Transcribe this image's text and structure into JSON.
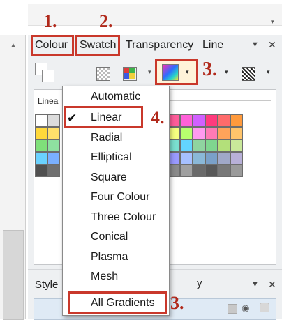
{
  "tabs": [
    {
      "label": "Colour",
      "marker": "1."
    },
    {
      "label": "Swatch",
      "marker": "2."
    },
    {
      "label": "Transparency"
    },
    {
      "label": "Line"
    }
  ],
  "panel_controls": {
    "menu_glyph": "▼",
    "close_glyph": "✕"
  },
  "toolbar": {
    "marker": "3.",
    "gradient_preview_colors": [
      "#ff2fb4",
      "#2f6bff",
      "#28d7c9",
      "#ffdf2a"
    ]
  },
  "swatch_panel": {
    "label": "Linea"
  },
  "swatch_colors": [
    [
      "#ffffff",
      "#dcdcdc",
      "#ff5c9a",
      "#ff60d8",
      "#d060ff",
      "#ff3b7d",
      "#ff6b6b",
      "#ff9a3c"
    ],
    [
      "#ffd83a",
      "#ffe06b",
      "#f6ff80",
      "#b7ff6e",
      "#ff9af0",
      "#ff7ab5",
      "#ffa35a",
      "#ffc46b"
    ],
    [
      "#7fe07a",
      "#8ee0a0",
      "#7ae0d0",
      "#63d4ff",
      "#8fd4a0",
      "#7fd68f",
      "#b3e07a",
      "#c9e89a"
    ],
    [
      "#6ad2ff",
      "#7ab0ff",
      "#9a9aff",
      "#a6c0ff",
      "#8ab8d8",
      "#7aa0c8",
      "#a0a8c8",
      "#b8b0d8"
    ],
    [
      "#505050",
      "#707070",
      "#8a8a8a",
      "#a0a0a0",
      "#6a6a6a",
      "#585858",
      "#787878",
      "#9a9a9a"
    ]
  ],
  "menu": {
    "items": [
      "Automatic",
      "Linear",
      "Radial",
      "Elliptical",
      "Square",
      "Four Colour",
      "Three Colour",
      "Conical",
      "Plasma",
      "Mesh",
      "All Gradients"
    ],
    "checked_index": 1,
    "check_glyph": "✔",
    "linear_marker": "4.",
    "all_gradients_marker": "3."
  },
  "styles_panel": {
    "label": "Style",
    "partial_label": "y",
    "menu_glyph": "▼",
    "close_glyph": "✕"
  }
}
